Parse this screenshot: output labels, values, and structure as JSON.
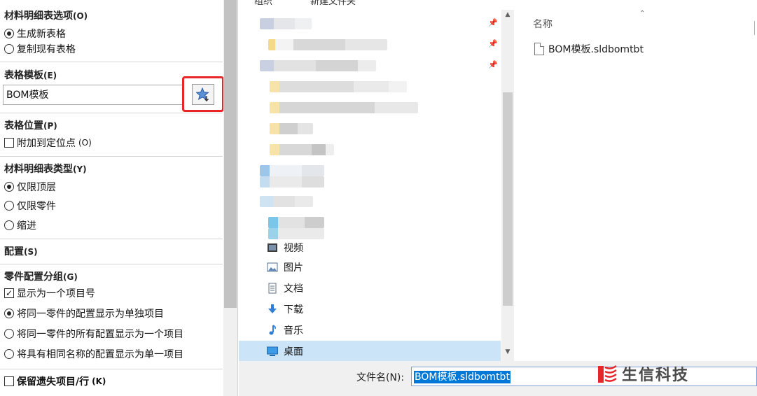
{
  "left_panel": {
    "bom_options": {
      "title": "材料明细表选项",
      "hotkey": "(O)",
      "options": [
        "生成新表格",
        "复制现有表格"
      ],
      "selected": 0
    },
    "table_template": {
      "title": "表格模板",
      "hotkey": "(E)",
      "value": "BOM模板"
    },
    "table_position": {
      "title": "表格位置",
      "hotkey": "(P)",
      "checkbox_label": "附加到定位点",
      "checkbox_hotkey": "(O)",
      "checked": false
    },
    "bom_type": {
      "title": "材料明细表类型",
      "hotkey": "(Y)",
      "options": [
        "仅限顶层",
        "仅限零件",
        "缩进"
      ],
      "selected": 0
    },
    "configuration": {
      "title": "配置",
      "hotkey": "(S)"
    },
    "part_config_grouping": {
      "title": "零件配置分组",
      "hotkey": "(G)",
      "checkbox_label": "显示为一个项目号",
      "checked": true,
      "options": [
        "将同一零件的配置显示为单独项目",
        "将同一零件的所有配置显示为一个项目",
        "将具有相同名称的配置显示为单一项目"
      ],
      "selected": 0
    },
    "keep_missing": {
      "title": "保留遗失项目/行",
      "hotkey": "(K)",
      "checked": false
    }
  },
  "dialog": {
    "toolbar": {
      "organize": "组织",
      "new_folder": "新建文件夹"
    },
    "nav_items": [
      {
        "label": "视频",
        "icon": "video-icon"
      },
      {
        "label": "图片",
        "icon": "pictures-icon"
      },
      {
        "label": "文档",
        "icon": "documents-icon"
      },
      {
        "label": "下载",
        "icon": "download-icon"
      },
      {
        "label": "音乐",
        "icon": "music-icon"
      },
      {
        "label": "桌面",
        "icon": "desktop-icon"
      }
    ],
    "selected_nav": 5,
    "file_list": {
      "column_name": "名称",
      "files": [
        "BOM模板.sldbomtbt"
      ]
    },
    "filename_label": "文件名(N):",
    "filename_value": "BOM模板.sldbomtbt"
  },
  "watermark": {
    "text": "生信科技"
  },
  "colors": {
    "highlight_red": "#e8262a",
    "selection_blue": "#0078d7",
    "nav_selected": "#cce4f7"
  }
}
